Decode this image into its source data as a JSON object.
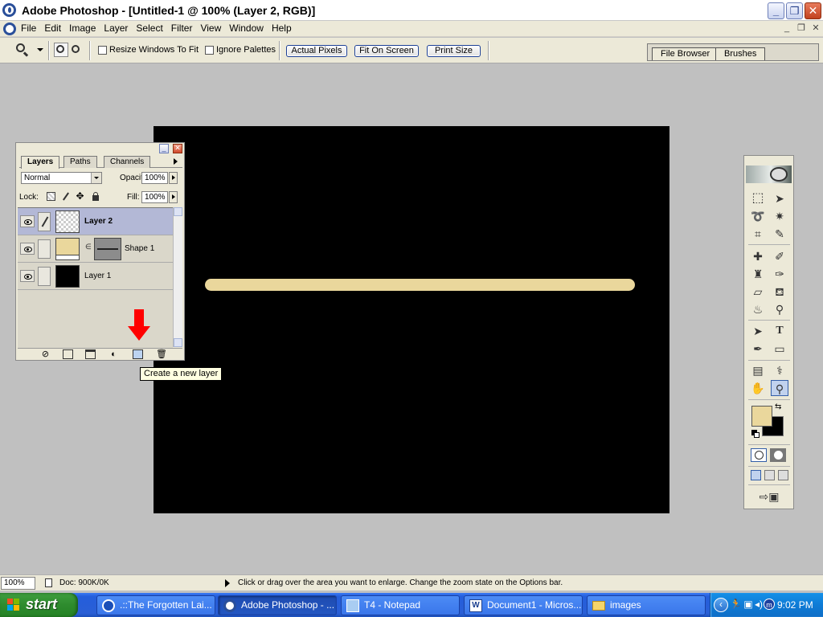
{
  "window": {
    "title": "Adobe Photoshop - [Untitled-1 @ 100% (Layer 2, RGB)]",
    "minimize": "_",
    "maximize": "❐",
    "close": "✕"
  },
  "menubar": {
    "items": [
      "File",
      "Edit",
      "Image",
      "Layer",
      "Select",
      "Filter",
      "View",
      "Window",
      "Help"
    ]
  },
  "options_bar": {
    "resize_windows_label": "Resize Windows To Fit",
    "resize_windows_checked": false,
    "ignore_palettes_label": "Ignore Palettes",
    "ignore_palettes_checked": false,
    "actual_pixels": "Actual Pixels",
    "fit_on_screen": "Fit On Screen",
    "print_size": "Print Size",
    "palette_well_tabs": [
      "File Browser",
      "Brushes"
    ]
  },
  "canvas": {
    "background": "#000000",
    "stroke_color": "#ead79c"
  },
  "layers_palette": {
    "tabs": [
      "Layers",
      "Paths",
      "Channels"
    ],
    "active_tab": "Layers",
    "blend_mode": "Normal",
    "opacity_label": "Opacity:",
    "opacity": "100%",
    "lock_label": "Lock:",
    "fill_label": "Fill:",
    "fill": "100%",
    "layers": [
      {
        "name": "Layer 2",
        "selected": true,
        "thumbnail": "transparent"
      },
      {
        "name": "Shape 1",
        "selected": false,
        "thumbnail": "#ead79c"
      },
      {
        "name": "Layer 1",
        "selected": false,
        "thumbnail": "#000000"
      }
    ]
  },
  "tooltip": {
    "text": "Create a new layer"
  },
  "toolbox": {
    "foreground_color": "#ead79c",
    "background_color": "#000000",
    "active_tool": "zoom-tool"
  },
  "status_bar": {
    "zoom": "100%",
    "doc_size": "Doc: 900K/0K",
    "message": "Click or drag over the area you want to enlarge. Change the zoom state on the Options bar."
  },
  "taskbar": {
    "start_label": "start",
    "tasks": [
      {
        "label": ".::The Forgotten Lai...",
        "active": false
      },
      {
        "label": "Adobe Photoshop - ...",
        "active": true
      },
      {
        "label": "T4 - Notepad",
        "active": false
      },
      {
        "label": "Document1 - Micros...",
        "active": false
      },
      {
        "label": "images",
        "active": false
      }
    ],
    "clock": "9:02 PM"
  }
}
